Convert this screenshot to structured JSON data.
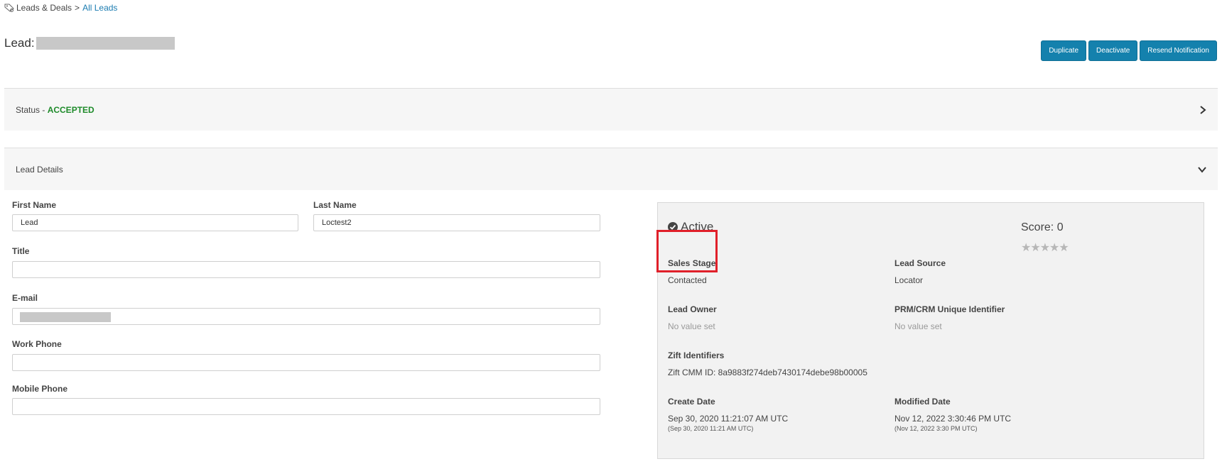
{
  "breadcrumb": {
    "root": "Leads & Deals",
    "separator": ">",
    "current": "All Leads"
  },
  "title": {
    "prefix": "Lead:"
  },
  "actions": {
    "duplicate": "Duplicate",
    "deactivate": "Deactivate",
    "resend": "Resend Notification"
  },
  "status_section": {
    "label": "Status - ",
    "value": "ACCEPTED"
  },
  "details_section": {
    "label": "Lead Details"
  },
  "form": {
    "first_name_label": "First Name",
    "first_name_value": "Lead",
    "last_name_label": "Last Name",
    "last_name_value": "Loctest2",
    "title_label": "Title",
    "title_value": "",
    "email_label": "E-mail",
    "work_phone_label": "Work Phone",
    "work_phone_value": "",
    "mobile_phone_label": "Mobile Phone",
    "mobile_phone_value": ""
  },
  "summary": {
    "status": "Active",
    "score_label": "Score: 0",
    "stars": "★★★★★",
    "rating": 0,
    "sales_stage_label": "Sales Stage",
    "sales_stage_value": "Contacted",
    "lead_source_label": "Lead Source",
    "lead_source_value": "Locator",
    "lead_owner_label": "Lead Owner",
    "lead_owner_value": "No value set",
    "prm_label": "PRM/CRM Unique Identifier",
    "prm_value": "No value set",
    "zift_label": "Zift Identifiers",
    "zift_value": "Zift CMM ID: 8a9883f274deb7430174debe98b00005",
    "create_label": "Create Date",
    "create_value": "Sep 30, 2020 11:21:07 AM UTC",
    "create_local": "(Sep 30, 2020 11:21 AM UTC)",
    "modified_label": "Modified Date",
    "modified_value": "Nov 12, 2022 3:30:46 PM UTC",
    "modified_local": "(Nov 12, 2022 3:30 PM UTC)"
  },
  "colors": {
    "accent": "#1481ad",
    "accepted": "#1e8b2a",
    "highlight": "#e0202a"
  }
}
